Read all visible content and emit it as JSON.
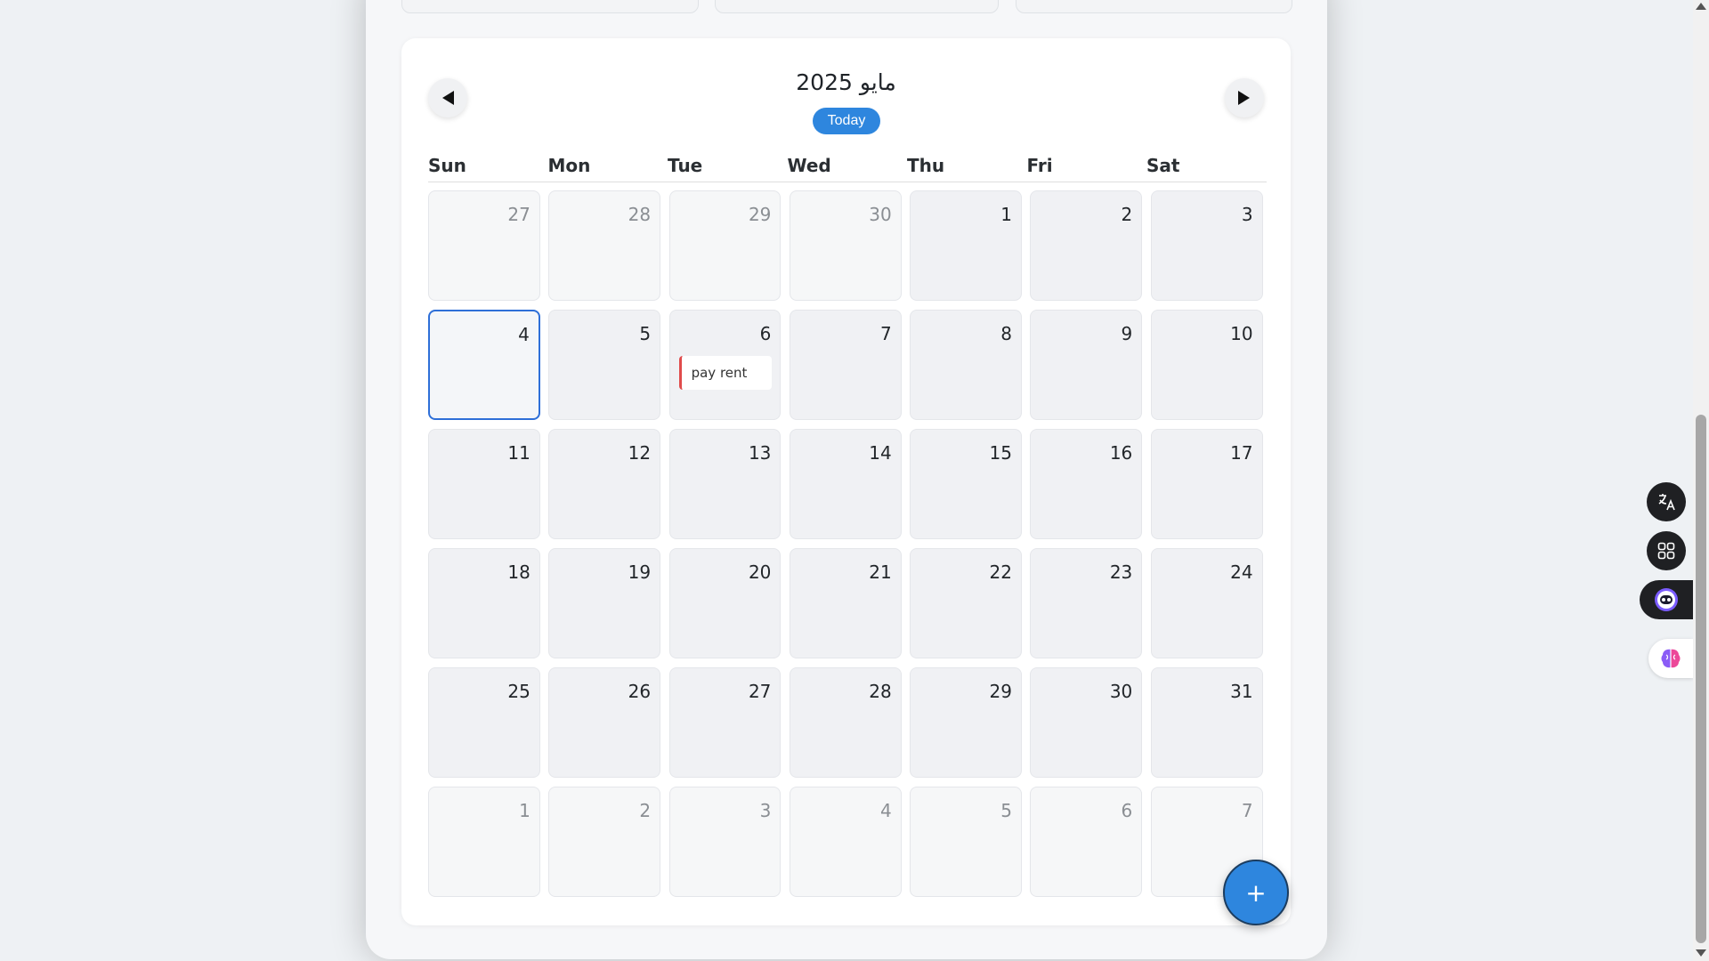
{
  "header": {
    "month_title": "مايو 2025",
    "today_label": "Today",
    "prev_icon": "triangle-left-icon",
    "next_icon": "triangle-right-icon"
  },
  "weekdays": [
    "Sun",
    "Mon",
    "Tue",
    "Wed",
    "Thu",
    "Fri",
    "Sat"
  ],
  "days": [
    {
      "num": "27",
      "other": true
    },
    {
      "num": "28",
      "other": true
    },
    {
      "num": "29",
      "other": true
    },
    {
      "num": "30",
      "other": true
    },
    {
      "num": "1"
    },
    {
      "num": "2"
    },
    {
      "num": "3"
    },
    {
      "num": "4",
      "today": true
    },
    {
      "num": "5"
    },
    {
      "num": "6",
      "event": "pay rent"
    },
    {
      "num": "7"
    },
    {
      "num": "8"
    },
    {
      "num": "9"
    },
    {
      "num": "10"
    },
    {
      "num": "11"
    },
    {
      "num": "12"
    },
    {
      "num": "13"
    },
    {
      "num": "14"
    },
    {
      "num": "15"
    },
    {
      "num": "16"
    },
    {
      "num": "17"
    },
    {
      "num": "18"
    },
    {
      "num": "19"
    },
    {
      "num": "20"
    },
    {
      "num": "21"
    },
    {
      "num": "22"
    },
    {
      "num": "23"
    },
    {
      "num": "24"
    },
    {
      "num": "25"
    },
    {
      "num": "26"
    },
    {
      "num": "27"
    },
    {
      "num": "28"
    },
    {
      "num": "29"
    },
    {
      "num": "30"
    },
    {
      "num": "31"
    },
    {
      "num": "1",
      "other": true
    },
    {
      "num": "2",
      "other": true
    },
    {
      "num": "3",
      "other": true
    },
    {
      "num": "4",
      "other": true
    },
    {
      "num": "5",
      "other": true
    },
    {
      "num": "6",
      "other": true
    },
    {
      "num": "7",
      "other": true
    }
  ],
  "fab": {
    "label": "+",
    "icon": "plus-icon"
  },
  "side_tools": [
    {
      "name": "translate-icon"
    },
    {
      "name": "apps-grid-icon"
    },
    {
      "name": "assistant-face-icon"
    },
    {
      "name": "brain-icon"
    }
  ],
  "colors": {
    "accent": "#2e86de",
    "event_bar": "#e04b4b",
    "today_border": "#2e6fd8"
  }
}
